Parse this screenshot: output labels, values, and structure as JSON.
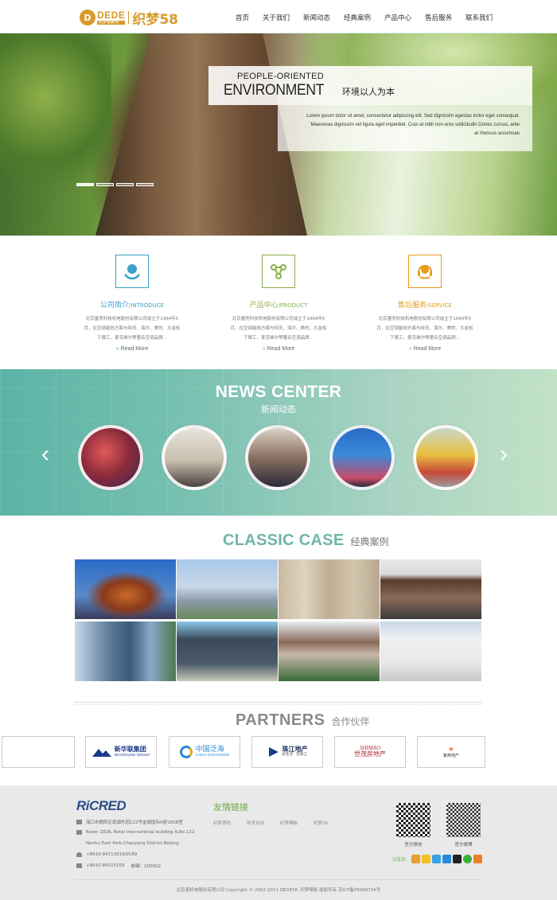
{
  "header": {
    "logo_badge": "D",
    "logo_main": "DEDE",
    "logo_sub": "织梦模板网",
    "logo_cn": "织梦58",
    "nav": [
      "首页",
      "关于我们",
      "新闻动态",
      "经典案例",
      "产品中心",
      "售后服务",
      "联系我们"
    ]
  },
  "banner": {
    "heading_small": "PEOPLE-ORIENTED",
    "heading_large": "ENVIRONMENT",
    "heading_cn": "环境以人为本",
    "desc": "Lorem ipsum dolor sit amet, consectetur adipiscing elit. Sed dignissim egestas tortor eget consequat. Maecenas dignissim vel ligula eget imperdiet. Cras at nibh non eros sollicitudin Donec cursus, ante at rhoncus accumsan",
    "slides": 4,
    "active_slide": 1
  },
  "services": [
    {
      "title_cn": "公司简介",
      "title_en": "/INTRODUCE",
      "color": "#3aa0c8",
      "icon": "globe-hands-icon",
      "desc": "北京量壳科技机电股份有限公司成立于1994年5月，在空调能效方面与特灵、海尔、美的、大金松下眼工、麦克维尔等著名空调品牌...",
      "more": "Read More"
    },
    {
      "title_cn": "产品中心",
      "title_en": "/PRODUCT",
      "color": "#8ab04a",
      "icon": "molecule-icon",
      "desc": "北京量壳科技机电股份有限公司成立于1994年5月，在空调能效方面与特灵、海尔、美的、大金松下眼工、麦克维尔等著名空调品牌...",
      "more": "Read More"
    },
    {
      "title_cn": "售后服务",
      "title_en": "/SERVICE",
      "color": "#e89a1a",
      "icon": "headset-icon",
      "desc": "北京量壳科技机电股份有限公司成立于1994年5月，在空调能效方面与特灵、海尔、美的、大金松下眼工、麦克维尔等著名空调品牌...",
      "more": "Read More"
    }
  ],
  "news": {
    "title": "NEWS CENTER",
    "subtitle": "新闻动态",
    "prev": "‹",
    "next": "›",
    "thumbs": [
      "news-photo-1",
      "news-photo-2",
      "news-photo-3",
      "news-photo-4",
      "news-photo-5"
    ]
  },
  "cases": {
    "title_en": "CLASSIC CASE",
    "title_cn": "经典案例",
    "images": [
      "teapot-building",
      "city-skyline",
      "apartment-towers",
      "office-building",
      "glass-tower",
      "office-block",
      "villas",
      "white-building"
    ]
  },
  "partners": {
    "title_en": "PARTNERS",
    "title_cn": "合作伙伴",
    "logos": [
      {
        "name": "新华联集团",
        "sub": "MACROLINK GROUP"
      },
      {
        "name": "中国泛海",
        "sub": "CHINA OCEANWIDE"
      },
      {
        "name": "珠江地产",
        "sub": "好生活 · 在珠江"
      },
      {
        "name": "世茂房地产",
        "sub": "SHIMAO"
      },
      {
        "name": "紫荆地产",
        "sub": ""
      }
    ]
  },
  "footer": {
    "logo": "RiCRED",
    "address1": "海口市朝阳区南湖东园122号金城国际A座1808室",
    "address2": "Room 1828, Botai international building A,No.122",
    "address3": "Nanhu East Park,Chaoyang District,Beijing",
    "phone": "+8610-84713019/0189",
    "fax": "+8610-84315159",
    "postcode": "邮编：100002",
    "links_title": "友情链接",
    "links": [
      "织梦源码",
      "技术支持",
      "织梦模板",
      "织梦58"
    ],
    "qr1_label": "官方微信",
    "qr2_label": "官方微博",
    "share_label": "分享到：",
    "copyright": "北京某机电股份有限公司     Copyright © 2002-2011 DEDE58. 织梦模板 版权所有 京ICP备09999734号"
  }
}
